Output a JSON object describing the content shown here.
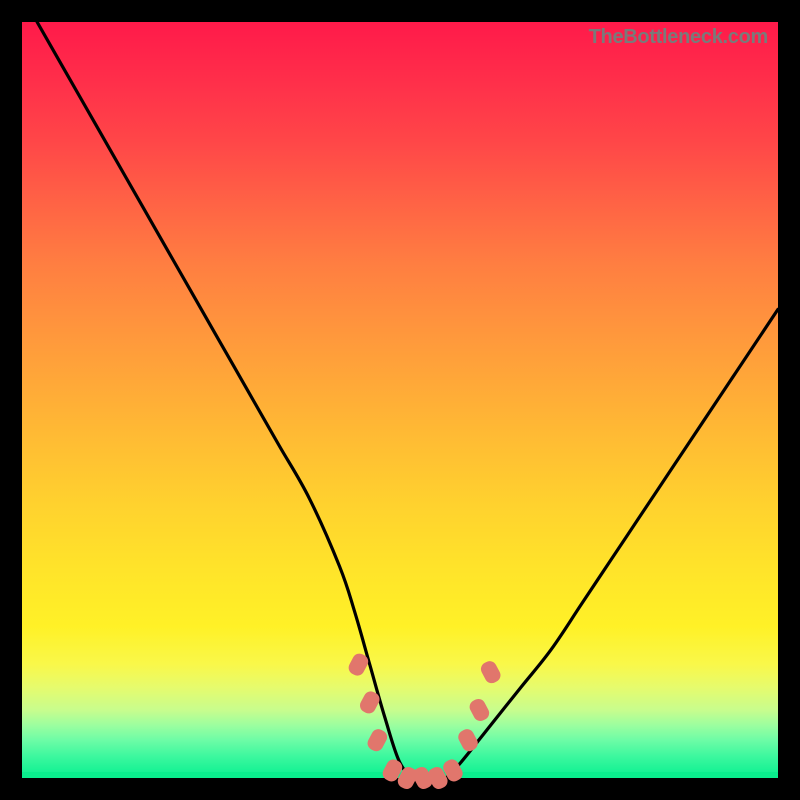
{
  "watermark": "TheBottleneck.com",
  "chart_data": {
    "type": "line",
    "title": "",
    "xlabel": "",
    "ylabel": "",
    "xlim": [
      0,
      100
    ],
    "ylim": [
      0,
      100
    ],
    "grid": false,
    "legend": false,
    "series": [
      {
        "name": "bottleneck-curve",
        "color": "#000000",
        "x": [
          2,
          6,
          10,
          14,
          18,
          22,
          26,
          30,
          34,
          38,
          42,
          44,
          46,
          48,
          50,
          52,
          54,
          56,
          58,
          62,
          66,
          70,
          74,
          78,
          82,
          86,
          90,
          94,
          98,
          100
        ],
        "y": [
          100,
          93,
          86,
          79,
          72,
          65,
          58,
          51,
          44,
          37,
          28,
          22,
          15,
          8,
          2,
          0,
          0,
          0,
          2,
          7,
          12,
          17,
          23,
          29,
          35,
          41,
          47,
          53,
          59,
          62
        ]
      }
    ],
    "markers": [
      {
        "name": "valley-markers",
        "color": "#e1766c",
        "points": [
          {
            "x": 44.5,
            "y": 15
          },
          {
            "x": 46.0,
            "y": 10
          },
          {
            "x": 47.0,
            "y": 5
          },
          {
            "x": 49.0,
            "y": 1
          },
          {
            "x": 51.0,
            "y": 0
          },
          {
            "x": 53.0,
            "y": 0
          },
          {
            "x": 55.0,
            "y": 0
          },
          {
            "x": 57.0,
            "y": 1
          },
          {
            "x": 59.0,
            "y": 5
          },
          {
            "x": 60.5,
            "y": 9
          },
          {
            "x": 62.0,
            "y": 14
          }
        ]
      }
    ]
  }
}
